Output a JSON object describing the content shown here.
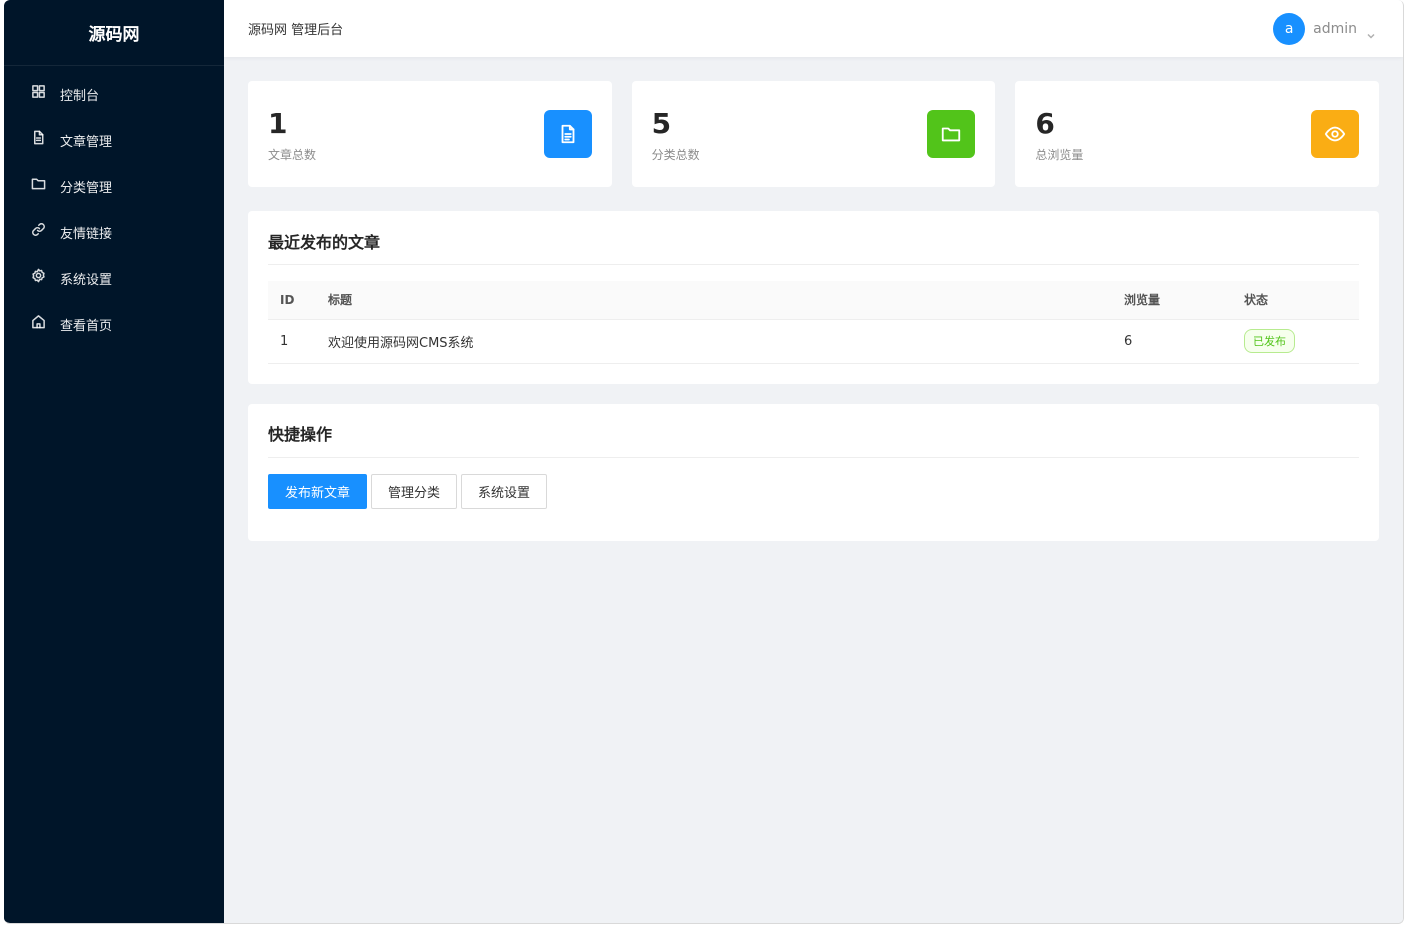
{
  "sidebar": {
    "logo": "源码网",
    "items": [
      {
        "label": "控制台",
        "icon": "dashboard-icon"
      },
      {
        "label": "文章管理",
        "icon": "file-icon"
      },
      {
        "label": "分类管理",
        "icon": "folder-icon"
      },
      {
        "label": "友情链接",
        "icon": "link-icon"
      },
      {
        "label": "系统设置",
        "icon": "gear-icon"
      },
      {
        "label": "查看首页",
        "icon": "home-icon"
      }
    ]
  },
  "header": {
    "title": "源码网 管理后台",
    "avatar_letter": "a",
    "username": "admin"
  },
  "stats": [
    {
      "value": "1",
      "label": "文章总数",
      "icon": "document-icon",
      "color": "#1890ff"
    },
    {
      "value": "5",
      "label": "分类总数",
      "icon": "folder-icon",
      "color": "#52c41a"
    },
    {
      "value": "6",
      "label": "总浏览量",
      "icon": "eye-icon",
      "color": "#faad14"
    }
  ],
  "recent": {
    "title": "最近发布的文章",
    "columns": {
      "id": "ID",
      "title": "标题",
      "views": "浏览量",
      "status": "状态"
    },
    "rows": [
      {
        "id": "1",
        "title": "欢迎使用源码网CMS系统",
        "views": "6",
        "status": "已发布"
      }
    ]
  },
  "quick": {
    "title": "快捷操作",
    "buttons": {
      "publish": "发布新文章",
      "categories": "管理分类",
      "settings": "系统设置"
    }
  }
}
